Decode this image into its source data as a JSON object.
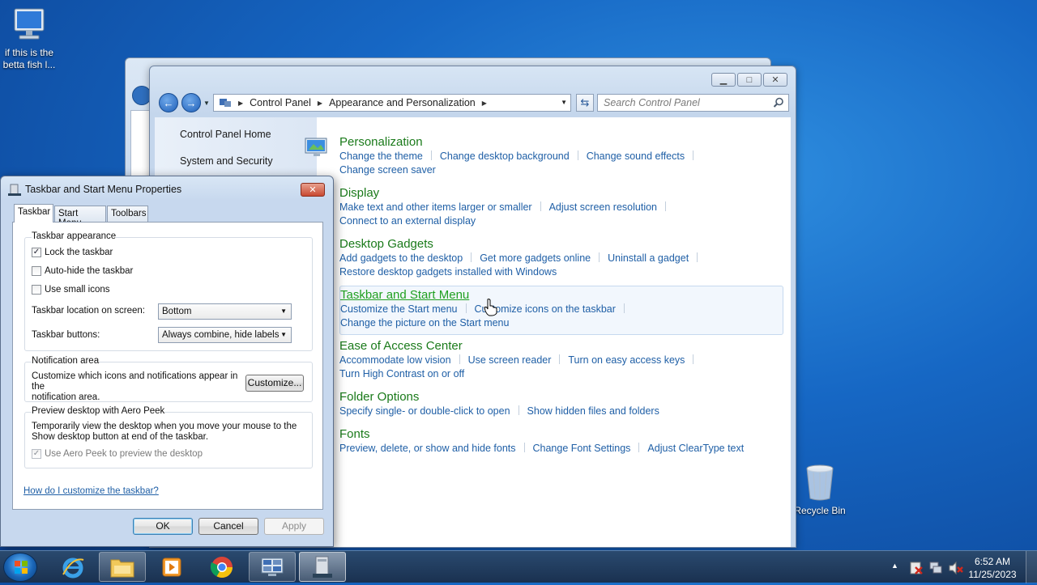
{
  "desktop": {
    "icon1_label_line1": "if this is the",
    "icon1_label_line2": "betta fish l...",
    "recycle_label": "Recycle Bin"
  },
  "control_panel": {
    "address": {
      "root": "Control Panel",
      "current": "Appearance and Personalization"
    },
    "search_placeholder": "Search Control Panel",
    "sidebar": [
      "Control Panel Home",
      "System and Security"
    ],
    "categories": [
      {
        "title": "Personalization",
        "links": [
          "Change the theme",
          "Change desktop background",
          "Change sound effects",
          "Change screen saver"
        ]
      },
      {
        "title": "Display",
        "links": [
          "Make text and other items larger or smaller",
          "Adjust screen resolution",
          "Connect to an external display"
        ]
      },
      {
        "title": "Desktop Gadgets",
        "links": [
          "Add gadgets to the desktop",
          "Get more gadgets online",
          "Uninstall a gadget",
          "Restore desktop gadgets installed with Windows"
        ]
      },
      {
        "title": "Taskbar and Start Menu",
        "links": [
          "Customize the Start menu",
          "Customize icons on the taskbar",
          "Change the picture on the Start menu"
        ]
      },
      {
        "title": "Ease of Access Center",
        "links": [
          "Accommodate low vision",
          "Use screen reader",
          "Turn on easy access keys",
          "Turn High Contrast on or off"
        ]
      },
      {
        "title": "Folder Options",
        "links": [
          "Specify single- or double-click to open",
          "Show hidden files and folders"
        ]
      },
      {
        "title": "Fonts",
        "links": [
          "Preview, delete, or show and hide fonts",
          "Change Font Settings",
          "Adjust ClearType text"
        ]
      }
    ]
  },
  "dialog": {
    "title": "Taskbar and Start Menu Properties",
    "tabs": [
      "Taskbar",
      "Start Menu",
      "Toolbars"
    ],
    "appearance": {
      "heading": "Taskbar appearance",
      "lock": {
        "label": "Lock the taskbar",
        "checked": true
      },
      "autohide": {
        "label": "Auto-hide the taskbar",
        "checked": false
      },
      "small_icons": {
        "label": "Use small icons",
        "checked": false
      },
      "location_label": "Taskbar location on screen:",
      "location_value": "Bottom",
      "buttons_label": "Taskbar buttons:",
      "buttons_value": "Always combine, hide labels"
    },
    "notification": {
      "heading": "Notification area",
      "text_line1": "Customize which icons and notifications appear in the",
      "text_line2": "notification area.",
      "button": "Customize..."
    },
    "peek": {
      "heading": "Preview desktop with Aero Peek",
      "text_line1": "Temporarily view the desktop when you move your mouse to the",
      "text_line2": "Show desktop button at end of the taskbar.",
      "checkbox_label": "Use Aero Peek to preview the desktop",
      "checked": true
    },
    "help_link": "How do I customize the taskbar?",
    "ok": "OK",
    "cancel": "Cancel",
    "apply": "Apply"
  },
  "taskbar": {
    "time": "6:52 AM",
    "date": "11/25/2023",
    "pinned": [
      "internet-explorer-icon",
      "file-explorer-icon",
      "media-player-icon",
      "chrome-icon",
      "control-panel-icon",
      "taskbar-properties-icon"
    ]
  },
  "colors": {
    "category_title": "#1a7a1a",
    "link": "#1f5fa6",
    "desktop": "#1667c4"
  }
}
